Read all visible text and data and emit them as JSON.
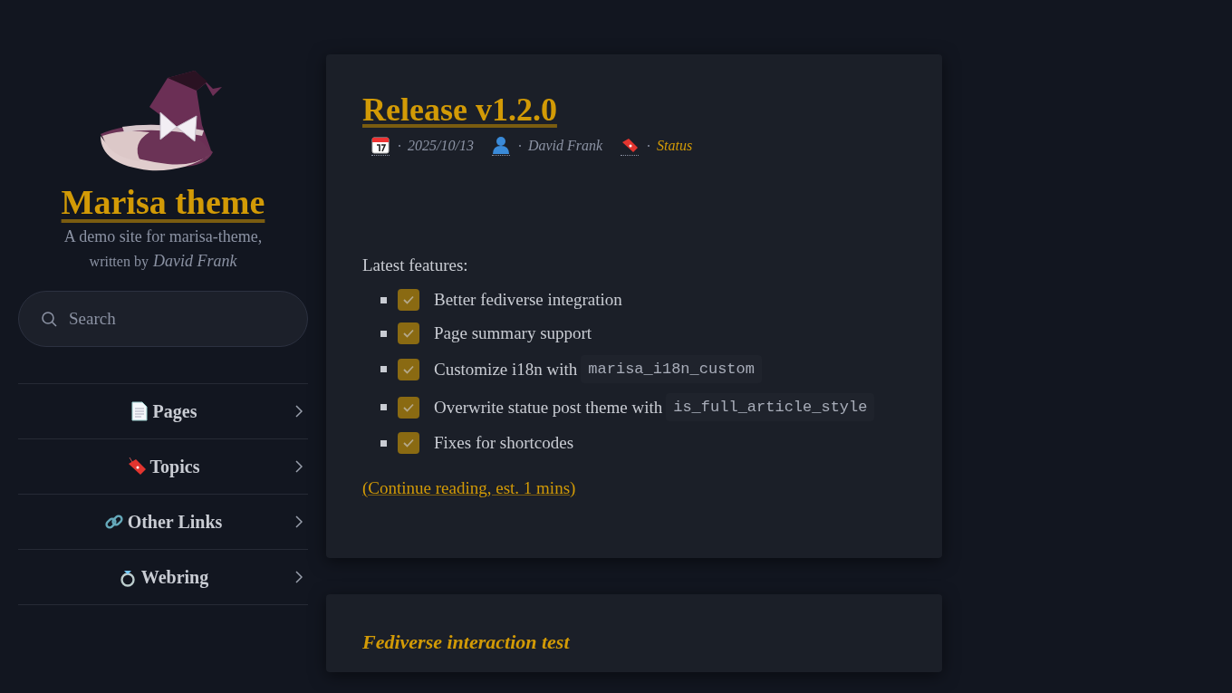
{
  "site": {
    "title": "Marisa theme",
    "tagline": "A demo site for marisa-theme,",
    "byline_prefix": "written by",
    "byline_author": "David Frank"
  },
  "search": {
    "placeholder": "Search"
  },
  "nav": [
    {
      "label": "Pages"
    },
    {
      "label": "Topics"
    },
    {
      "label": "Other Links"
    },
    {
      "label": "Webring"
    }
  ],
  "posts": [
    {
      "title": "Release v1.2.0",
      "date": "2025/10/13",
      "author": "David Frank",
      "category": "Status",
      "intro": "Latest features:",
      "features": [
        {
          "text": "Better fediverse integration",
          "checked": true
        },
        {
          "text": "Page summary support",
          "checked": true
        },
        {
          "text": "Customize i18n with",
          "code": "marisa_i18n_custom",
          "checked": true
        },
        {
          "text": "Overwrite statue post theme with",
          "code": "is_full_article_style",
          "checked": true
        },
        {
          "text": "Fixes for shortcodes",
          "checked": true
        }
      ],
      "continue": "(Continue reading, est. 1 mins)"
    },
    {
      "title": "Fediverse interaction test"
    }
  ]
}
